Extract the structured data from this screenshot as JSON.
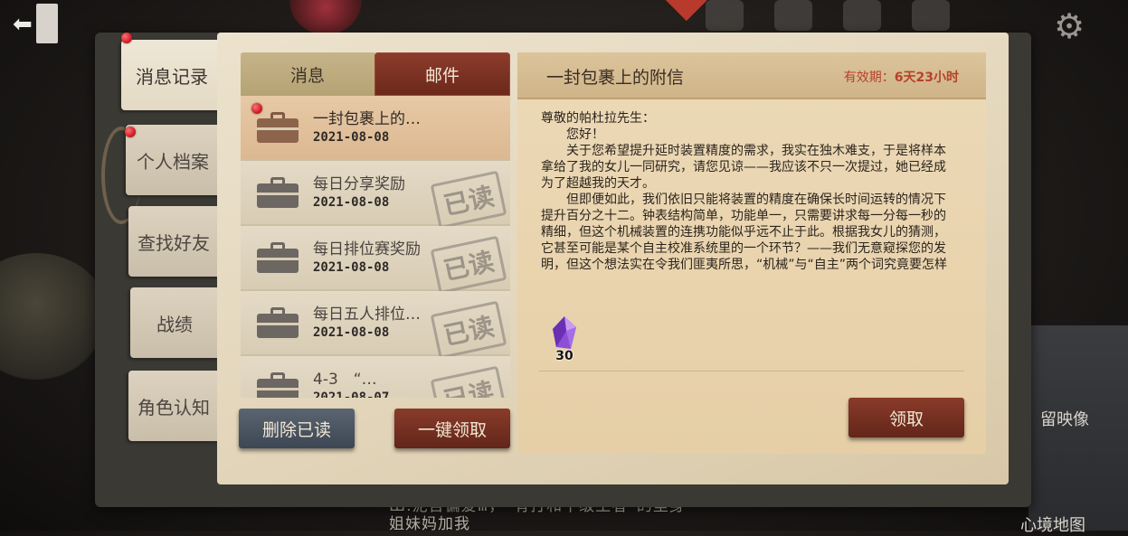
{
  "sidebar": {
    "tabs": [
      {
        "label": "消息记录",
        "active": true,
        "badge": true
      },
      {
        "label": "个人档案",
        "active": false,
        "badge": true
      },
      {
        "label": "查找好友",
        "active": false,
        "badge": false
      },
      {
        "label": "战绩",
        "active": false,
        "badge": false
      },
      {
        "label": "角色认知",
        "active": false,
        "badge": false
      }
    ]
  },
  "list_tabs": {
    "messages": "消息",
    "mail": "邮件",
    "active": "mail"
  },
  "mail_list": [
    {
      "title": "一封包裹上的…",
      "date": "2021-08-08",
      "read": false,
      "selected": true,
      "unread_dot": true
    },
    {
      "title": "每日分享奖励",
      "date": "2021-08-08",
      "read": true,
      "selected": false
    },
    {
      "title": "每日排位赛奖励",
      "date": "2021-08-08",
      "read": true,
      "selected": false
    },
    {
      "title": "每日五人排位…",
      "date": "2021-08-08",
      "read": true,
      "selected": false
    },
    {
      "title": "4-3　“…",
      "date": "2021-08-07",
      "read": true,
      "selected": false
    }
  ],
  "read_stamp": "已读",
  "buttons": {
    "delete_read": "删除已读",
    "claim_all": "一键领取",
    "claim": "领取"
  },
  "letter": {
    "title": "一封包裹上的附信",
    "validity_label": "有效期：",
    "validity_value": "6天23小时",
    "greeting": "尊敬的帕杜拉先生：",
    "paragraphs": [
      "您好！",
      "关于您希望提升延时装置精度的需求，我实在独木难支，于是将样本拿给了我的女儿一同研究，请您见谅——我应该不只一次提过，她已经成为了超越我的天才。",
      "但即便如此，我们依旧只能将装置的精度在确保长时间运转的情况下提升百分之十二。钟表结构简单，功能单一，只需要讲求每一分每一秒的精细，但这个机械装置的连携功能似乎远不止于此。根据我女儿的猜测，它甚至可能是某个自主校准系统里的一个环节？——我们无意窥探您的发明，但这个想法实在令我们匪夷所思，“机械”与“自主”两个词究竟要怎样"
    ],
    "attachment": {
      "icon": "purple-crystal-icon",
      "quantity": "30"
    }
  },
  "background": {
    "bottom_text_line1": "Ш.泥吾偏爱Ⅲ，“有打和千级土者”的里身",
    "bottom_text_line2": "姐妹妈加我",
    "right_label1": "留映像",
    "right_label2": "心境地图"
  },
  "colors": {
    "mail_tab": "#7a3222",
    "validity": "#b8412a",
    "delete_button": "#4a5461",
    "claim_button": "#7a3222",
    "unread_dot": "#d0202a"
  }
}
